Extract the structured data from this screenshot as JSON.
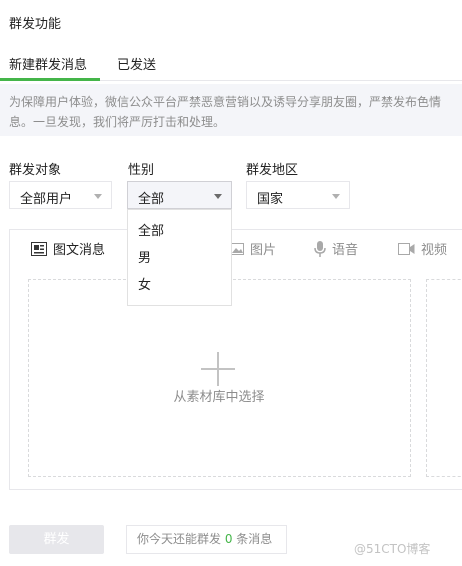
{
  "header": {
    "title": "群发功能"
  },
  "tabs": [
    {
      "label": "新建群发消息",
      "active": true
    },
    {
      "label": "已发送",
      "active": false
    }
  ],
  "notice": {
    "line1": "为保障用户体验，微信公众平台严禁恶意营销以及诱导分享朋友圈，严禁发布色情",
    "line2": "息。一旦发现，我们将严厉打击和处理。"
  },
  "filters": {
    "target": {
      "label": "群发对象",
      "value": "全部用户"
    },
    "gender": {
      "label": "性别",
      "value": "全部",
      "options": [
        "全部",
        "男",
        "女"
      ]
    },
    "region": {
      "label": "群发地区",
      "value": "国家"
    }
  },
  "message_types": [
    {
      "label": "图文消息",
      "icon": "news-icon"
    },
    {
      "label": "图片",
      "icon": "image-icon"
    },
    {
      "label": "语音",
      "icon": "microphone-icon"
    },
    {
      "label": "视频",
      "icon": "video-icon"
    }
  ],
  "material_panel": {
    "text": "从素材库中选择"
  },
  "footer": {
    "send_label": "群发",
    "quota_prefix": "你今天还能群发 ",
    "quota_count": "0",
    "quota_suffix": " 条消息"
  },
  "watermark": "@51CTO博客",
  "colors": {
    "accent": "#44b549",
    "notice_bg": "#f4f5f9",
    "border": "#e7e7eb"
  }
}
